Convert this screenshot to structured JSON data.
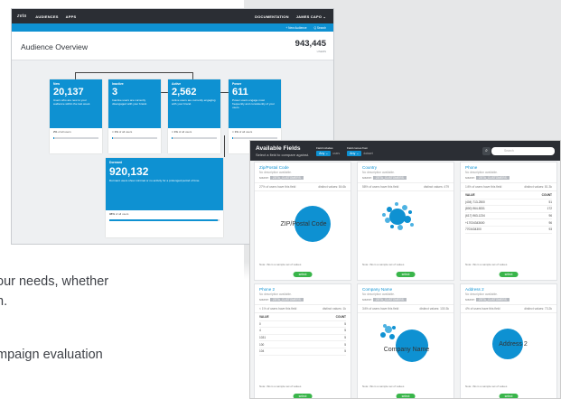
{
  "colors": {
    "brand": "#0e91d2",
    "nav": "#2b2e34",
    "select": "#39b54a"
  },
  "nav": {
    "logo": "zeta",
    "items": [
      "AUDIENCES",
      "APPS"
    ],
    "right": [
      "DOCUMENTATION",
      "JAMES CAPO ⌄"
    ]
  },
  "subbar": {
    "new_audience": "+ New Audience",
    "search": "Q Search"
  },
  "overview": {
    "title": "Audience Overview",
    "total": "943,445",
    "total_unit": "USERS"
  },
  "cards": [
    {
      "label": "New",
      "count": "20,137",
      "desc": "Users who are new to your audience within the last week.",
      "pct": "2%",
      "pct_suffix": "of all users",
      "fill": 0.02
    },
    {
      "label": "Inactive",
      "count": "3",
      "desc": "Inactive users are currently disengaged with your brand.",
      "pct": "< 1%",
      "pct_suffix": "of all users",
      "fill": 0.005
    },
    {
      "label": "Active",
      "count": "2,562",
      "desc": "Active users are currently engaging with your brand.",
      "pct": "< 1%",
      "pct_suffix": "of all users",
      "fill": 0.005
    },
    {
      "label": "Power",
      "count": "611",
      "desc": "Power users engage most frequently and consistently of your users.",
      "pct": "< 1%",
      "pct_suffix": "of all users",
      "fill": 0.005
    },
    {
      "label": "Dormant",
      "count": "920,132",
      "desc": "Dormant users show minimal or no activity for a prolonged period of time.",
      "pct": "98%",
      "pct_suffix": "of all users",
      "fill": 0.98
    }
  ],
  "fields_panel": {
    "title": "Available Fields",
    "subtitle": "Select a field to compare against.",
    "filter1_label": "Field includes",
    "filter1_value": "Any ⌄",
    "filter1_suffix": "users",
    "filter2_label": "Field comes from",
    "filter2_value": "Any ⌄",
    "filter2_suffix": "dataset",
    "search_placeholder": "Search",
    "search_icon": "search-icon"
  },
  "fields": [
    {
      "name": "Zip/Postal Code",
      "na": "No description available.",
      "source": "source:",
      "tag": "ZETA_CUSTOMERS",
      "stat_l": "27% of users have this field",
      "stat_r": "distinct values: 84.6k",
      "viz": "ZIP/Postal Code",
      "note": "Note: this is a sample set of values",
      "select": "select"
    },
    {
      "name": "Country",
      "na": "No description available.",
      "source": "source:",
      "tag": "ZETA_CUSTOMERS",
      "stat_l": "58% of users have this field",
      "stat_r": "distinct values: 479",
      "viz": "",
      "note": "Note: this is a sample set of values",
      "select": "select"
    },
    {
      "name": "Phone",
      "na": "No description available.",
      "source": "source:",
      "tag": "ZETA_CUSTOMERS",
      "stat_l": "14% of users have this field",
      "stat_r": "distinct values: 81.3k",
      "table": {
        "h": [
          "VALUE",
          "COUNT"
        ],
        "rows": [
          [
            "(404) 713-2500",
            "51"
          ],
          [
            "(800) 964-8331",
            "172"
          ],
          [
            "(617) 963-1234",
            "96"
          ],
          [
            "+17034343600",
            "96"
          ],
          [
            "7703434300",
            "93"
          ]
        ]
      },
      "note": "Note: this is a sample set of values",
      "select": "select"
    },
    {
      "name": "Phone 2",
      "na": "No description available.",
      "source": "source:",
      "tag": "ZETA_CUSTOMERS",
      "stat_l": "< 1% of users have this field",
      "stat_r": "distinct values: 1k",
      "table": {
        "h": [
          "VALUE",
          "COUNT"
        ],
        "rows": [
          [
            "0",
            "5"
          ],
          [
            "4",
            "5"
          ],
          [
            "1031",
            "5"
          ],
          [
            "100",
            "5"
          ],
          [
            "104",
            "5"
          ]
        ]
      },
      "note": "Note: this is a sample set of values",
      "select": "select"
    },
    {
      "name": "Company Name",
      "na": "No description available.",
      "source": "source:",
      "tag": "ZETA_CUSTOMERS",
      "stat_l": "34% of users have this field",
      "stat_r": "distinct values: 130.3k",
      "viz": "Company Name",
      "note": "Note: this is a sample set of values",
      "select": "select"
    },
    {
      "name": "Address 2",
      "na": "No description available.",
      "source": "source:",
      "tag": "ZETA_CUSTOMERS",
      "stat_l": "4% of users have this field",
      "stat_r": "distinct values: 73.2k",
      "viz": "Address 2",
      "note": "Note: this is a sample set of values",
      "select": "select"
    }
  ],
  "copy": [
    "our needs, whether",
    "n.",
    "mpaign evaluation"
  ]
}
